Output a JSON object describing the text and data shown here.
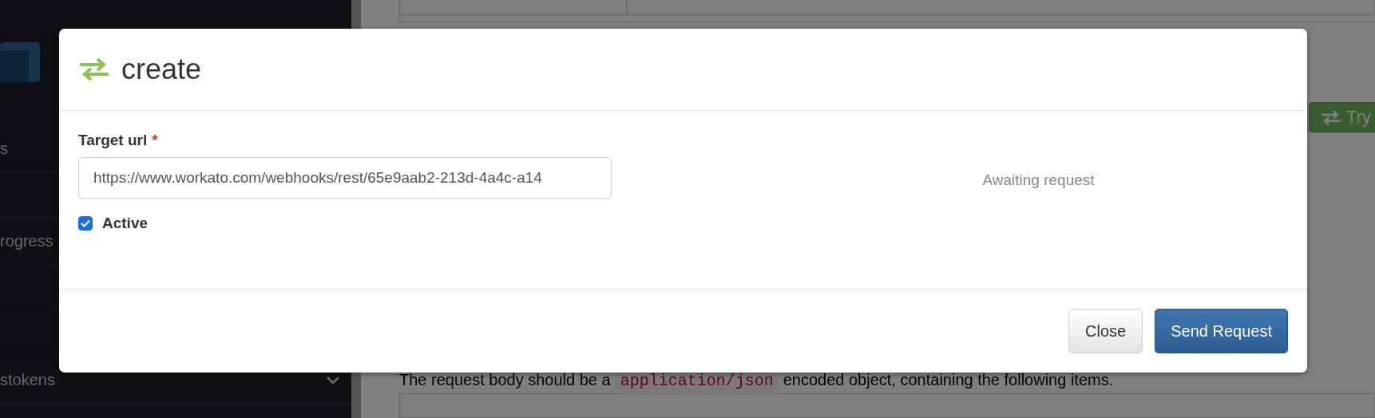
{
  "sidebar": {
    "items": [
      {
        "label": "s",
        "expandable": false
      },
      {
        "label": "rogress",
        "expandable": false
      },
      {
        "label": "stokens",
        "expandable": true
      }
    ]
  },
  "main": {
    "try_button": {
      "label": "Try"
    },
    "description": {
      "before": "The request body should be a",
      "code": "application/json",
      "after": "encoded object, containing the following items."
    }
  },
  "modal": {
    "title": "create",
    "field": {
      "label": "Target url",
      "required_mark": "*",
      "value": "https://www.workato.com/webhooks/rest/65e9aab2-213d-4a4c-a14"
    },
    "status": "Awaiting request",
    "checkbox": {
      "label": "Active",
      "checked": true
    },
    "buttons": [
      {
        "label": "Close",
        "kind": "default"
      },
      {
        "label": "Send Request",
        "kind": "primary"
      }
    ]
  }
}
